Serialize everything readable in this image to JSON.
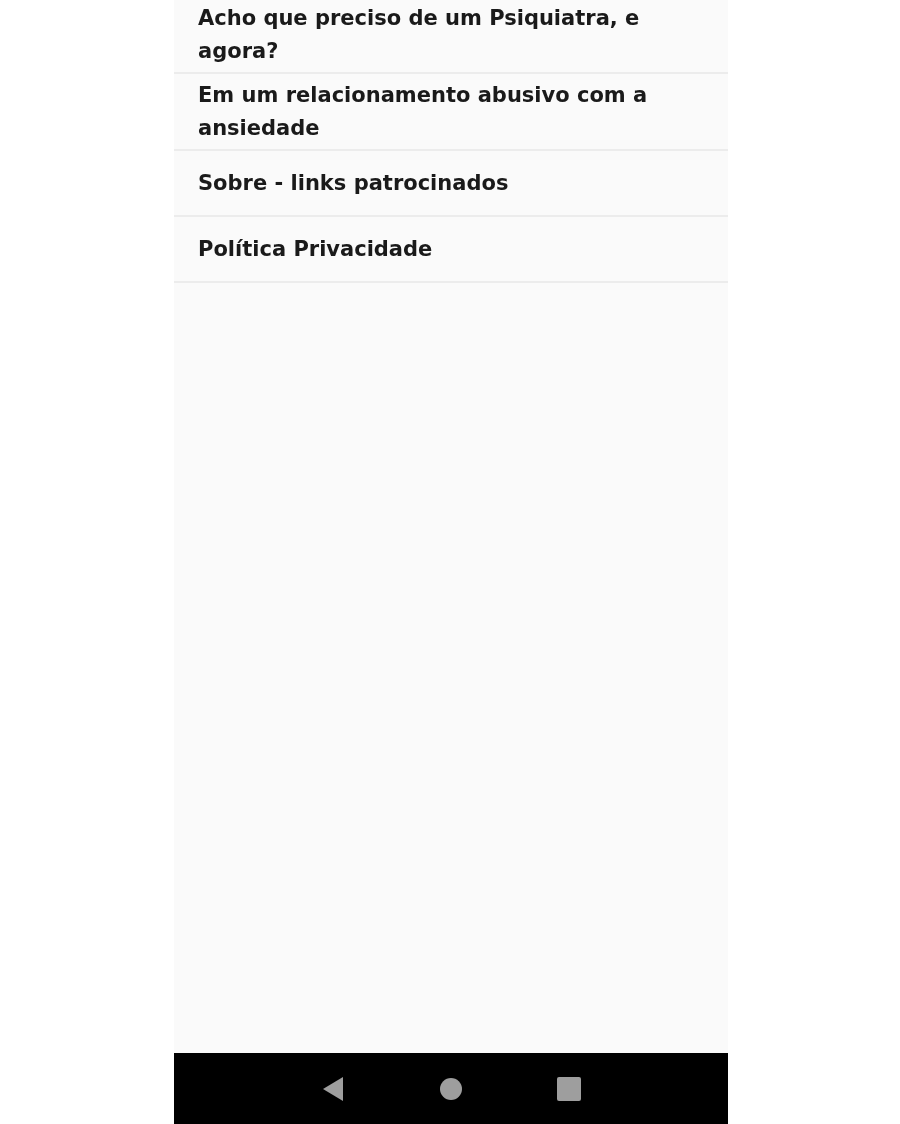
{
  "menu_items": [
    {
      "label": "Acho que preciso de um Psiquiatra, e agora?"
    },
    {
      "label": "Em um relacionamento abusivo com a ansiedade"
    },
    {
      "label": "Sobre - links patrocinados"
    },
    {
      "label": "Política Privacidade"
    }
  ]
}
